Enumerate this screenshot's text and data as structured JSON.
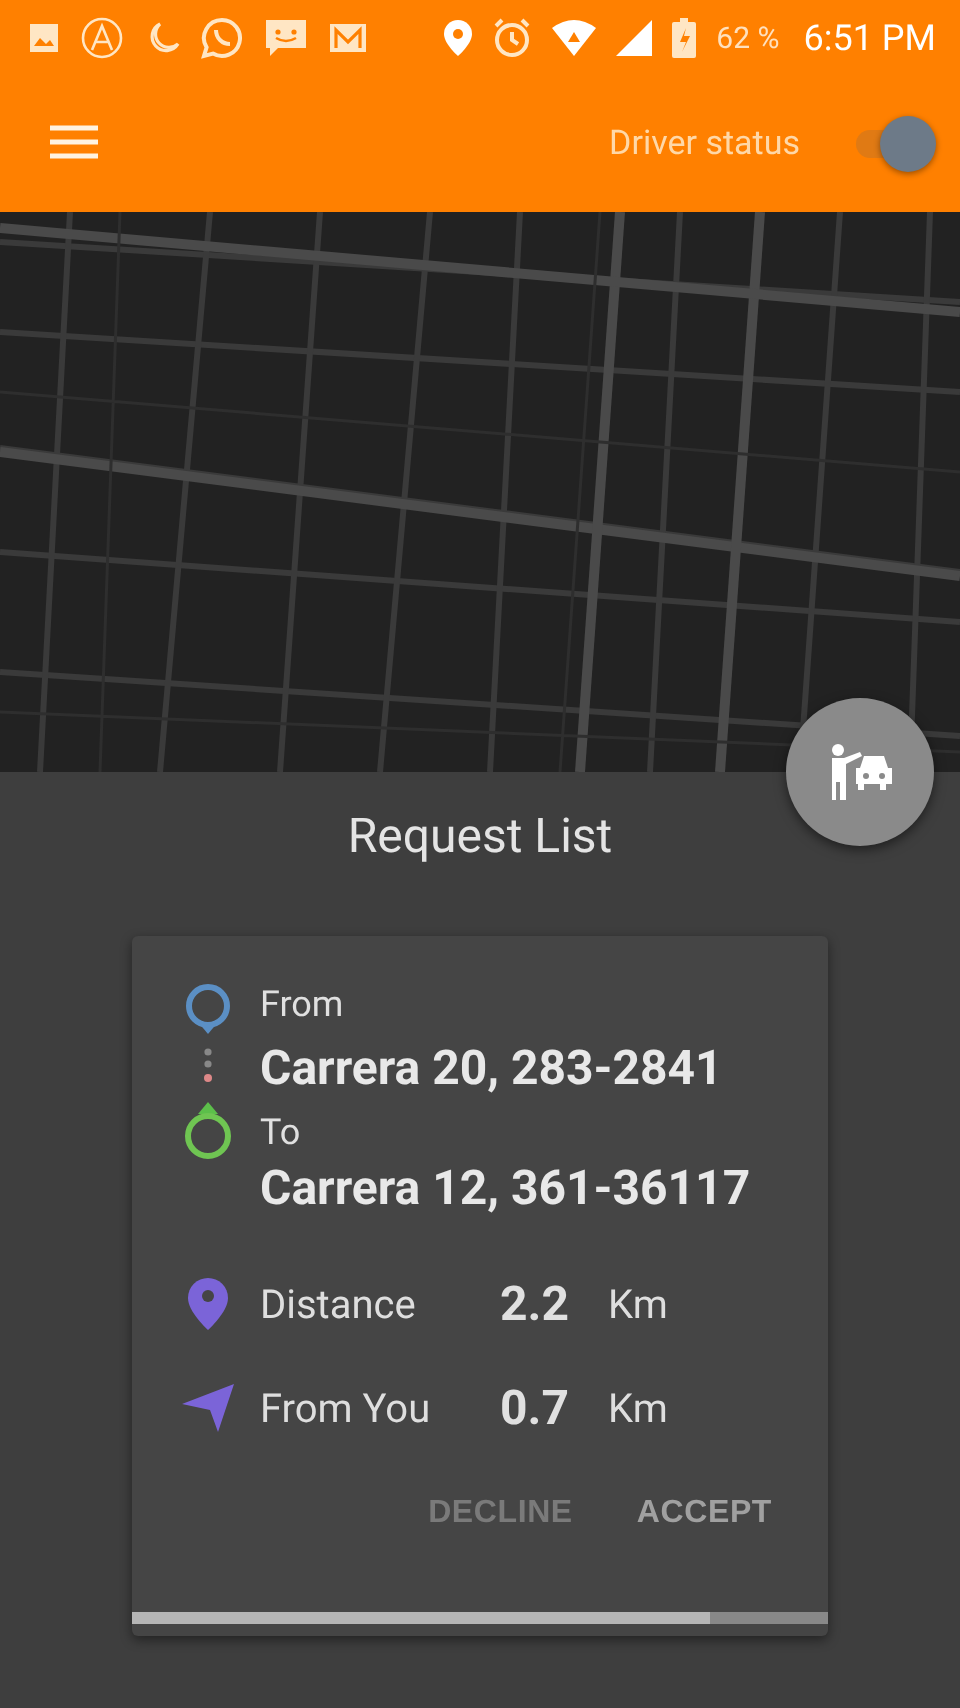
{
  "status_bar": {
    "battery": "62 %",
    "time": "6:51 PM"
  },
  "app_bar": {
    "title": "Driver status",
    "toggle_on": true
  },
  "panel": {
    "title": "Request List"
  },
  "request": {
    "from_label": "From",
    "from_address": "Carrera 20, 283-2841",
    "to_label": "To",
    "to_address": "Carrera 12, 361-36117",
    "stats": [
      {
        "kind": "distance",
        "label": "Distance",
        "value": "2.2",
        "unit": "Km"
      },
      {
        "kind": "direction",
        "label": "From You",
        "value": "0.7",
        "unit": "Km"
      }
    ],
    "buttons": [
      {
        "kind": "secondary",
        "label": "DECLINE"
      },
      {
        "kind": "primary",
        "label": "ACCEPT"
      }
    ],
    "timer": {
      "level": 0.83
    }
  }
}
